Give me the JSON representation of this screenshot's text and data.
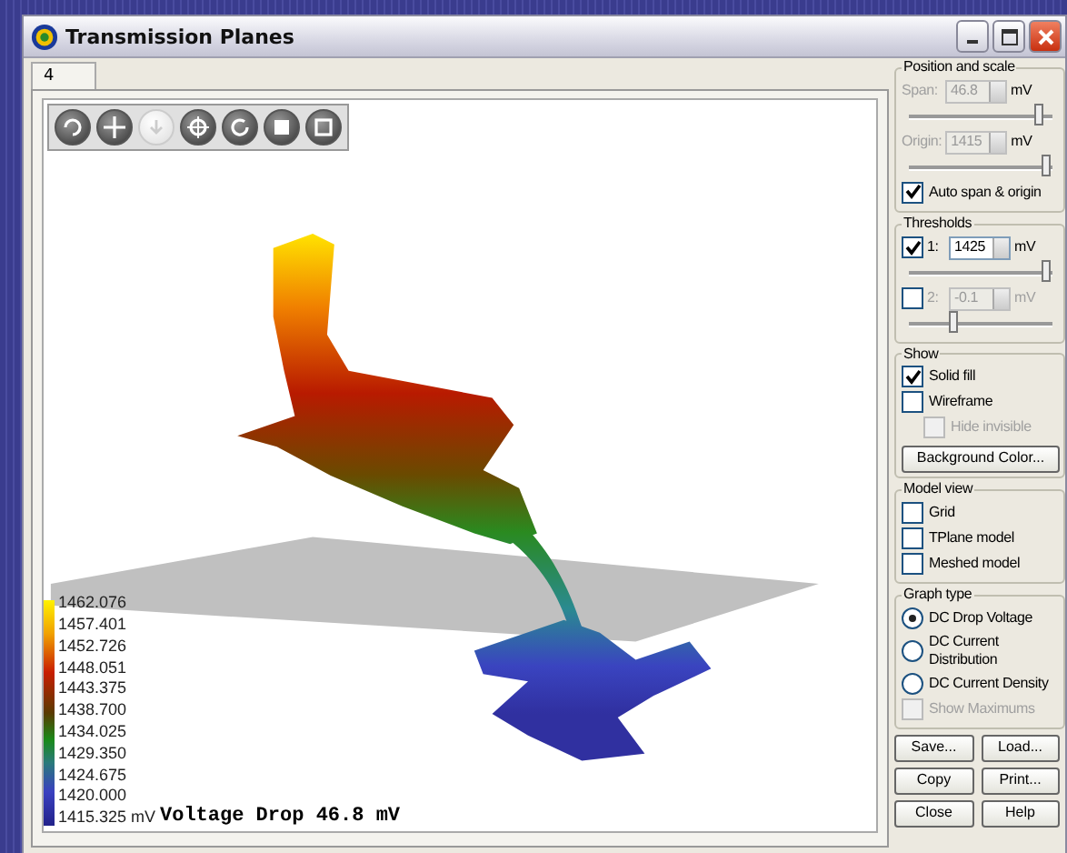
{
  "window": {
    "title": "Transmission Planes"
  },
  "tabs": [
    {
      "label": "4",
      "selected": true
    }
  ],
  "toolbar": [
    {
      "kind": "rotate",
      "disabled": false
    },
    {
      "kind": "move",
      "disabled": false
    },
    {
      "kind": "down",
      "disabled": true
    },
    {
      "kind": "zoom",
      "disabled": false
    },
    {
      "kind": "reset",
      "disabled": false
    },
    {
      "kind": "stop",
      "disabled": false
    },
    {
      "kind": "fit",
      "disabled": false
    }
  ],
  "legend": {
    "labels": [
      "1462.076",
      "1457.401",
      "1452.726",
      "1448.051",
      "1443.375",
      "1438.700",
      "1434.025",
      "1429.350",
      "1424.675",
      "1420.000",
      "1415.325 mV"
    ]
  },
  "caption": "Voltage Drop 46.8 mV",
  "position_and_scale": {
    "title": "Position and scale",
    "fields": [
      {
        "label": "Span:",
        "value": "46.8",
        "unit": "mV",
        "disabled": true,
        "level": 0.93
      },
      {
        "label": "Origin:",
        "value": "1415",
        "unit": "mV",
        "disabled": true,
        "level": 0.98
      }
    ],
    "auto": {
      "label": "Auto span & origin",
      "checked": true,
      "disabled": false
    }
  },
  "thresholds": {
    "title": "Thresholds",
    "items": [
      {
        "label": "1:",
        "checked": true,
        "value": "1425",
        "unit": "mV",
        "disabled": false,
        "level": 0.98
      },
      {
        "label": "2:",
        "checked": false,
        "value": "-0.1",
        "unit": "mV",
        "disabled": true,
        "level": 0.3
      }
    ]
  },
  "show": {
    "title": "Show",
    "items": [
      {
        "label": "Solid fill",
        "checked": true,
        "disabled": false
      },
      {
        "label": "Wireframe",
        "checked": false,
        "disabled": false,
        "children": [
          {
            "label": "Hide invisible",
            "checked": false,
            "disabled": true
          }
        ]
      }
    ],
    "button": "Background Color..."
  },
  "model_view": {
    "title": "Model view",
    "items": [
      {
        "label": "Grid",
        "checked": false,
        "disabled": false
      },
      {
        "label": "TPlane model",
        "checked": false,
        "disabled": false
      },
      {
        "label": "Meshed model",
        "checked": false,
        "disabled": false
      }
    ]
  },
  "graph_type": {
    "title": "Graph type",
    "options": [
      {
        "label": "DC Drop Voltage",
        "selected": true
      },
      {
        "label": "DC Current Distribution",
        "selected": false
      },
      {
        "label": "DC Current Density",
        "selected": false
      }
    ],
    "show_maximums": {
      "label": "Show Maximums",
      "checked": false,
      "disabled": true
    }
  },
  "buttons": [
    "Save...",
    "Load...",
    "Copy",
    "Print...",
    "Close",
    "Help"
  ]
}
